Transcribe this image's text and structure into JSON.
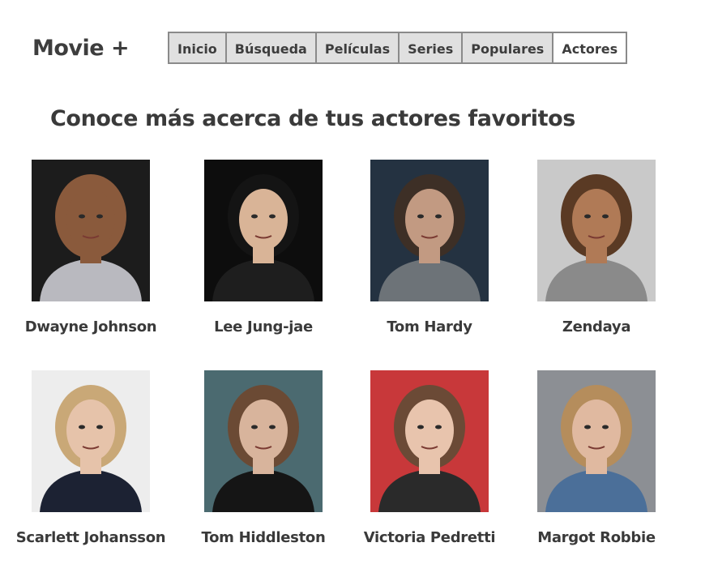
{
  "app": {
    "logo": "Movie +"
  },
  "nav": {
    "tabs": [
      {
        "label": "Inicio",
        "active": false
      },
      {
        "label": "Búsqueda",
        "active": false
      },
      {
        "label": "Películas",
        "active": false
      },
      {
        "label": "Series",
        "active": false
      },
      {
        "label": "Populares",
        "active": false
      },
      {
        "label": "Actores",
        "active": true
      }
    ]
  },
  "main": {
    "title": "Conoce más acerca de tus actores favoritos",
    "actors": [
      {
        "name": "Dwayne Johnson",
        "bg": "#1c1c1c",
        "skin": "#8a5a3c",
        "hair": "#8a5a3c",
        "cloth": "#b9b9bf"
      },
      {
        "name": "Lee Jung-jae",
        "bg": "#0d0d0d",
        "skin": "#d9b497",
        "hair": "#141414",
        "cloth": "#1e1e1e"
      },
      {
        "name": "Tom Hardy",
        "bg": "#243241",
        "skin": "#c29a82",
        "hair": "#3d2f26",
        "cloth": "#6d7378"
      },
      {
        "name": "Zendaya",
        "bg": "#c9c9c9",
        "skin": "#b07a56",
        "hair": "#5a3a24",
        "cloth": "#8a8a8a"
      },
      {
        "name": "Scarlett Johansson",
        "bg": "#ededed",
        "skin": "#e6c3aa",
        "hair": "#c9a877",
        "cloth": "#1c2233"
      },
      {
        "name": "Tom Hiddleston",
        "bg": "#4b6a70",
        "skin": "#d8b49c",
        "hair": "#6b4a34",
        "cloth": "#151515"
      },
      {
        "name": "Victoria Pedretti",
        "bg": "#c8383a",
        "skin": "#e8c4ad",
        "hair": "#6b4a36",
        "cloth": "#2a2a2a"
      },
      {
        "name": "Margot Robbie",
        "bg": "#8c8f94",
        "skin": "#e0b9a0",
        "hair": "#b58d5c",
        "cloth": "#4b6f99"
      }
    ]
  }
}
